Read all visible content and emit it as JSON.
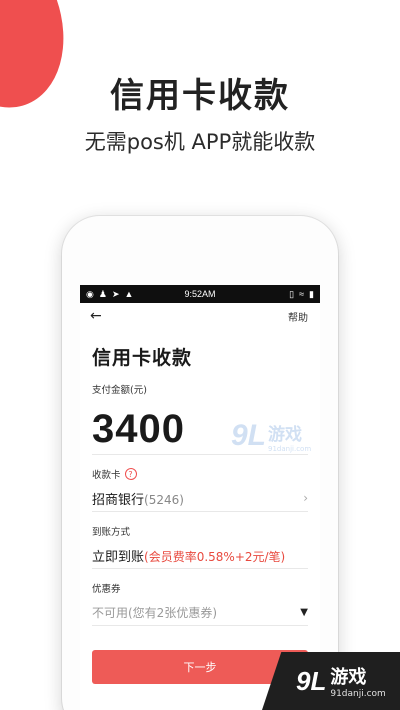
{
  "hero": {
    "title": "信用卡收款",
    "subtitle": "无需pos机 APP就能收款"
  },
  "status_bar": {
    "time": "9:52AM",
    "left_icons": [
      "currency-badge-icon",
      "person-icon",
      "navigation-icon",
      "android-icon"
    ],
    "right_icons": [
      "vibrate-icon",
      "wifi-icon",
      "battery-icon"
    ]
  },
  "nav": {
    "help_label": "帮助"
  },
  "page": {
    "title": "信用卡收款",
    "amount_label": "支付金额(元)",
    "amount_value": "3400",
    "card_label": "收款卡",
    "card_bank": "招商银行",
    "card_number": "(5246)",
    "settle_label": "到账方式",
    "settle_method": "立即到账",
    "settle_fee": "(会员费率0.58%+2元/笔)",
    "coupon_label": "优惠券",
    "coupon_value": "不可用(您有2张优惠券)",
    "next_button": "下一步"
  },
  "watermark": {
    "logo": "9L",
    "name": "游戏",
    "domain": "91danji.com"
  },
  "colors": {
    "accent": "#ee5b57",
    "fee_text": "#e84a3f",
    "status_bar": "#0f0f0f"
  }
}
